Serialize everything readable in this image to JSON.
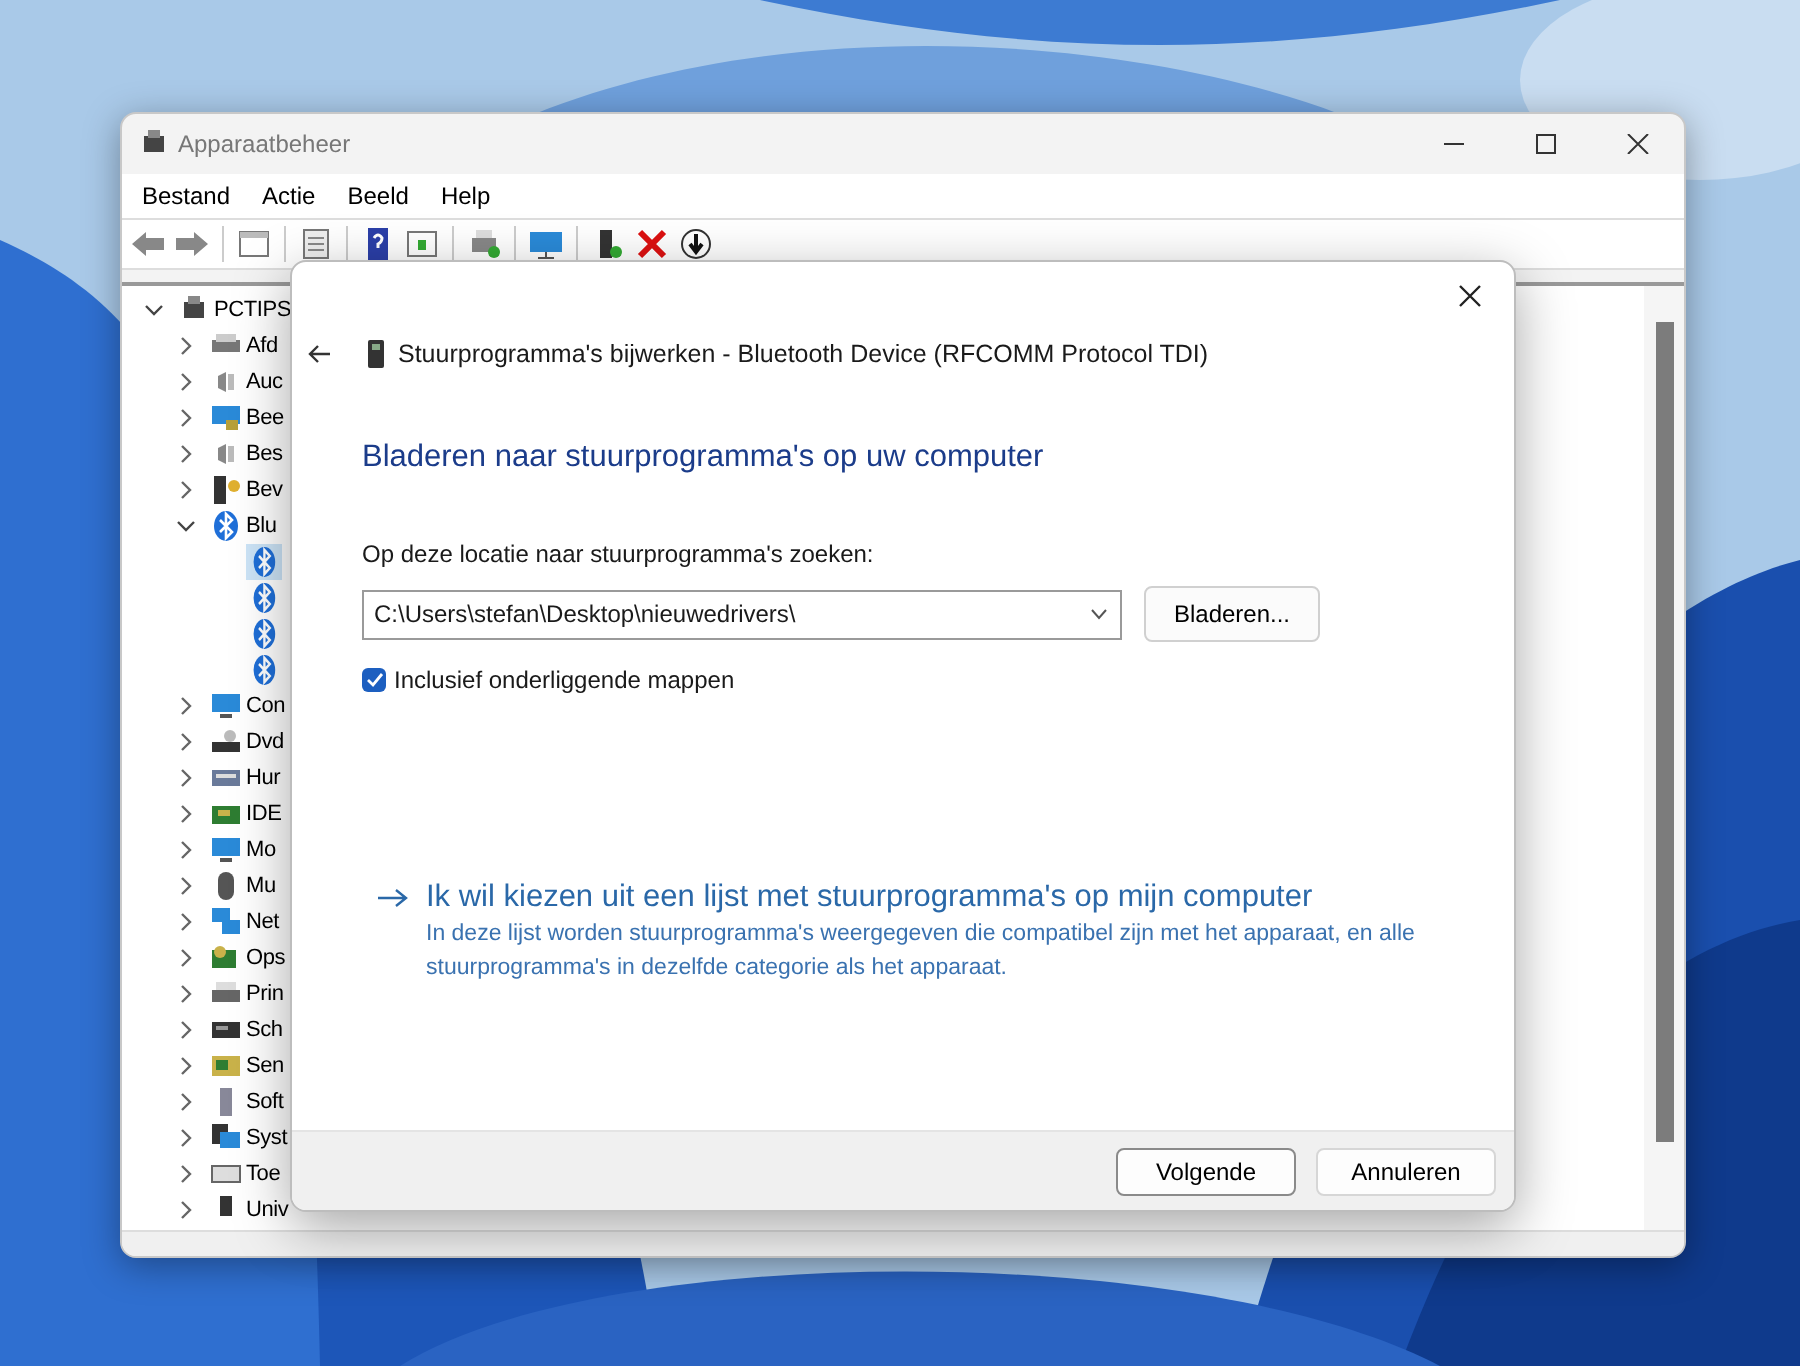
{
  "window": {
    "title": "Apparaatbeheer",
    "menu": [
      "Bestand",
      "Actie",
      "Beeld",
      "Help"
    ]
  },
  "tree": {
    "label": "PCTIPS",
    "expanded": true,
    "children": [
      {
        "label": "Afd",
        "expanded": false
      },
      {
        "label": "Auc",
        "expanded": false
      },
      {
        "label": "Bee",
        "expanded": false
      },
      {
        "label": "Bes",
        "expanded": false
      },
      {
        "label": "Bev",
        "expanded": false
      },
      {
        "label": "Blu",
        "expanded": true,
        "children": [
          {
            "selected": true
          },
          {
            "selected": false
          },
          {
            "selected": false
          },
          {
            "selected": false
          }
        ]
      },
      {
        "label": "Con",
        "expanded": false
      },
      {
        "label": "Dvd",
        "expanded": false
      },
      {
        "label": "Hur",
        "expanded": false
      },
      {
        "label": "IDE",
        "expanded": false
      },
      {
        "label": "Mo",
        "expanded": false
      },
      {
        "label": "Mu",
        "expanded": false
      },
      {
        "label": "Net",
        "expanded": false
      },
      {
        "label": "Ops",
        "expanded": false
      },
      {
        "label": "Prin",
        "expanded": false
      },
      {
        "label": "Sch",
        "expanded": false
      },
      {
        "label": "Sen",
        "expanded": false
      },
      {
        "label": "Soft",
        "expanded": false
      },
      {
        "label": "Syst",
        "expanded": false
      },
      {
        "label": "Toe",
        "expanded": false
      },
      {
        "label": "Univ",
        "expanded": false
      }
    ]
  },
  "dialog": {
    "title": "Stuurprogramma's bijwerken - Bluetooth Device (RFCOMM Protocol TDI)",
    "heading": "Bladeren naar stuurprogramma's op uw computer",
    "path_label": "Op deze locatie naar stuurprogramma's zoeken:",
    "path": {
      "value": "C:\\Users\\stefan\\Desktop\\nieuwedrivers\\"
    },
    "browse_button": "Bladeren...",
    "subfolders": {
      "label": "Inclusief onderliggende mappen",
      "checked": true
    },
    "option": {
      "title": "Ik wil kiezen uit een lijst met stuurprogramma's op mijn computer",
      "description": "In deze lijst worden stuurprogramma's weergegeven die compatibel zijn met het apparaat, en alle stuurprogramma's in dezelfde categorie als het apparaat."
    },
    "buttons": [
      {
        "label": "Volgende",
        "default": true
      },
      {
        "label": "Annuleren",
        "default": false
      }
    ]
  }
}
